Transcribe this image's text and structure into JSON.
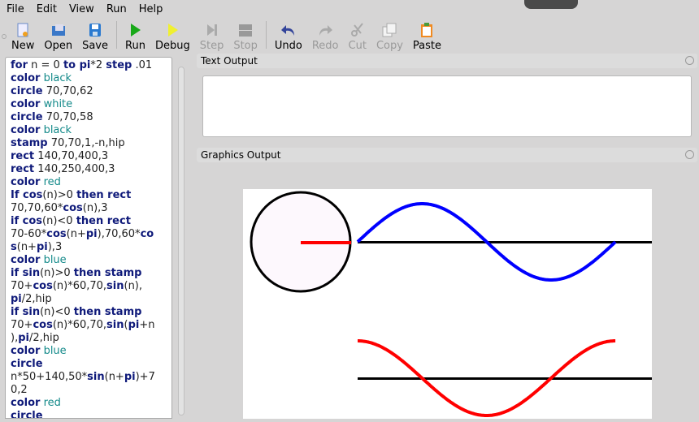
{
  "menu": [
    "File",
    "Edit",
    "View",
    "Run",
    "Help"
  ],
  "toolbar": [
    {
      "label": "New",
      "icon": "new-file-icon",
      "enabled": true
    },
    {
      "label": "Open",
      "icon": "open-folder-icon",
      "enabled": true
    },
    {
      "label": "Save",
      "icon": "save-icon",
      "enabled": true
    },
    {
      "label": "Run",
      "icon": "play-icon",
      "enabled": true
    },
    {
      "label": "Debug",
      "icon": "debug-icon",
      "enabled": true
    },
    {
      "label": "Step",
      "icon": "step-icon",
      "enabled": false
    },
    {
      "label": "Stop",
      "icon": "stop-icon",
      "enabled": false
    },
    {
      "label": "Undo",
      "icon": "undo-icon",
      "enabled": true
    },
    {
      "label": "Redo",
      "icon": "redo-icon",
      "enabled": false
    },
    {
      "label": "Cut",
      "icon": "scissors-icon",
      "enabled": false
    },
    {
      "label": "Copy",
      "icon": "copy-icon",
      "enabled": false
    },
    {
      "label": "Paste",
      "icon": "paste-icon",
      "enabled": true
    }
  ],
  "code": [
    [
      [
        "kw",
        "for"
      ],
      [
        "pl",
        " n = 0 "
      ],
      [
        "kw",
        "to pi"
      ],
      [
        "pl",
        "*2 "
      ],
      [
        "kw",
        "step"
      ],
      [
        "pl",
        " .01"
      ]
    ],
    [
      [
        "kw",
        "color"
      ],
      [
        "st",
        " black"
      ]
    ],
    [
      [
        "kw",
        "circle"
      ],
      [
        "pl",
        " 70,70,62"
      ]
    ],
    [
      [
        "kw",
        "color"
      ],
      [
        "st",
        " white"
      ]
    ],
    [
      [
        "kw",
        "circle"
      ],
      [
        "pl",
        " 70,70,58"
      ]
    ],
    [
      [
        "kw",
        "color"
      ],
      [
        "st",
        " black"
      ]
    ],
    [
      [
        "kw",
        "stamp"
      ],
      [
        "pl",
        " 70,70,1,-n,hip"
      ]
    ],
    [
      [
        "kw",
        "rect"
      ],
      [
        "pl",
        " 140,70,400,3"
      ]
    ],
    [
      [
        "kw",
        "rect"
      ],
      [
        "pl",
        " 140,250,400,3"
      ]
    ],
    [
      [
        "kw",
        "color"
      ],
      [
        "st",
        " red"
      ]
    ],
    [
      [
        "kw",
        "If cos"
      ],
      [
        "pl",
        "(n)>0 "
      ],
      [
        "kw",
        "then rect"
      ]
    ],
    [
      [
        "pl",
        "70,70,60*"
      ],
      [
        "kw",
        "cos"
      ],
      [
        "pl",
        "(n),3"
      ]
    ],
    [
      [
        "kw",
        "if cos"
      ],
      [
        "pl",
        "(n)<0 "
      ],
      [
        "kw",
        "then rect"
      ]
    ],
    [
      [
        "pl",
        "70-60*"
      ],
      [
        "kw",
        "cos"
      ],
      [
        "pl",
        "(n+"
      ],
      [
        "kw",
        "pi"
      ],
      [
        "pl",
        "),70,60*"
      ],
      [
        "kw",
        "co"
      ]
    ],
    [
      [
        "kw",
        "s"
      ],
      [
        "pl",
        "(n+"
      ],
      [
        "kw",
        "pi"
      ],
      [
        "pl",
        "),3"
      ]
    ],
    [
      [
        "kw",
        "color"
      ],
      [
        "st",
        " blue"
      ]
    ],
    [
      [
        "kw",
        "if sin"
      ],
      [
        "pl",
        "(n)>0 "
      ],
      [
        "kw",
        "then stamp"
      ]
    ],
    [
      [
        "pl",
        "70+"
      ],
      [
        "kw",
        "cos"
      ],
      [
        "pl",
        "(n)*60,70,"
      ],
      [
        "kw",
        "sin"
      ],
      [
        "pl",
        "(n),"
      ]
    ],
    [
      [
        "kw",
        "pi"
      ],
      [
        "pl",
        "/2,hip"
      ]
    ],
    [
      [
        "kw",
        "if sin"
      ],
      [
        "pl",
        "(n)<0 "
      ],
      [
        "kw",
        "then stamp"
      ]
    ],
    [
      [
        "pl",
        "70+"
      ],
      [
        "kw",
        "cos"
      ],
      [
        "pl",
        "(n)*60,70,"
      ],
      [
        "kw",
        "sin"
      ],
      [
        "pl",
        "("
      ],
      [
        "kw",
        "pi"
      ],
      [
        "pl",
        "+n"
      ]
    ],
    [
      [
        "pl",
        "),"
      ],
      [
        "kw",
        "pi"
      ],
      [
        "pl",
        "/2,hip"
      ]
    ],
    [
      [
        "kw",
        "color"
      ],
      [
        "st",
        " blue"
      ]
    ],
    [
      [
        "kw",
        "circle"
      ]
    ],
    [
      [
        "pl",
        "n*50+140,50*"
      ],
      [
        "kw",
        "sin"
      ],
      [
        "pl",
        "(n+"
      ],
      [
        "kw",
        "pi"
      ],
      [
        "pl",
        ")+7"
      ]
    ],
    [
      [
        "pl",
        "0,2"
      ]
    ],
    [
      [
        "kw",
        "color"
      ],
      [
        "st",
        " red"
      ]
    ],
    [
      [
        "kw",
        "circle"
      ]
    ]
  ],
  "docks": {
    "text_title": "Text Output",
    "graphics_title": "Graphics Output"
  },
  "colors": {
    "blue": "#0000ff",
    "red": "#ff0000",
    "black": "#000000",
    "circle_fill": "#fdf8fd"
  }
}
